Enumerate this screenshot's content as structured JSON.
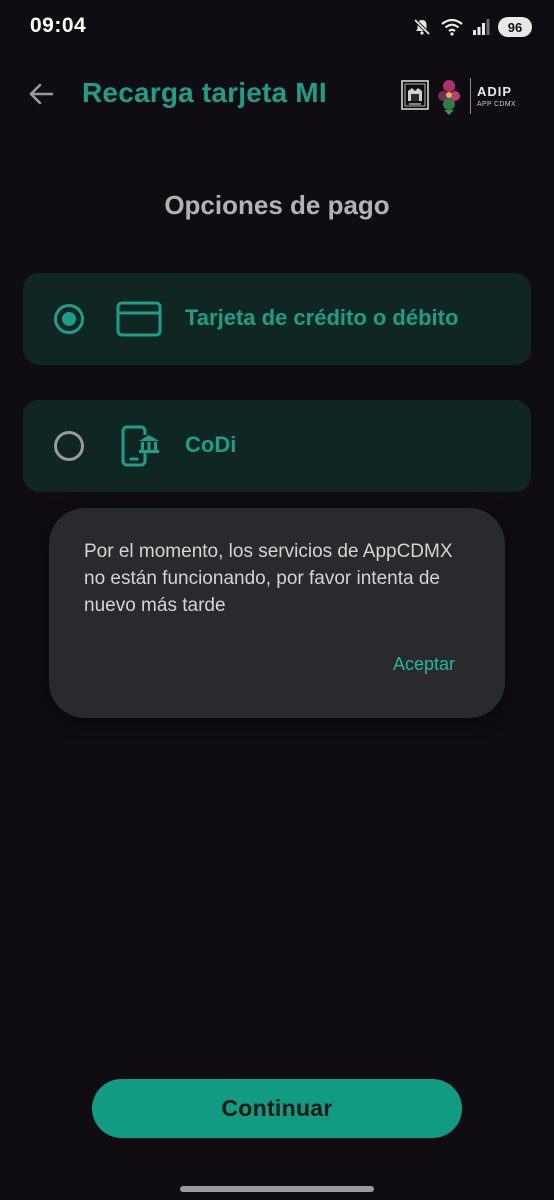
{
  "status_bar": {
    "time": "09:04",
    "battery": "96",
    "icons": [
      "mute-icon",
      "wifi-icon",
      "signal-icon",
      "battery-icon"
    ]
  },
  "header": {
    "back_icon": "arrow-left-icon",
    "title": "Recarga tarjeta MI",
    "logo_adip": "ADIP",
    "logo_app": "APP CDMX"
  },
  "section": {
    "title": "Opciones de pago"
  },
  "payment_options": [
    {
      "label": "Tarjeta de crédito o débito",
      "icon": "credit-card-icon",
      "selected": true
    },
    {
      "label": "CoDi",
      "icon": "mobile-bank-icon",
      "selected": false
    }
  ],
  "dialog": {
    "message": "Por el momento, los servicios de AppCDMX no están funcionando, por favor intenta de nuevo más tarde",
    "button": "Aceptar"
  },
  "footer": {
    "continue_label": "Continuar"
  },
  "colors": {
    "accent": "#1c9e87",
    "button": "#109b82",
    "background": "#0f0d11",
    "option_bg": "#0f2623",
    "dialog_bg": "#2a292e"
  }
}
